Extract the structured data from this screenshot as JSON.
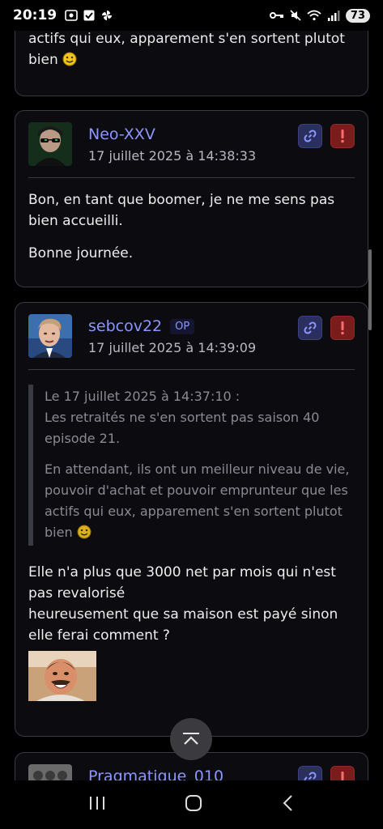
{
  "status_bar": {
    "time": "20:19",
    "battery": "73"
  },
  "posts": [
    {
      "fragment_text": "pouvoir d'achat et pouvoir emprunteur que les actifs qui eux, apparement s'en sortent plutot bien"
    },
    {
      "author": "Neo-XXV",
      "date": "17 juillet 2025 à 14:38:33",
      "paragraphs": [
        "Bon, en tant que boomer, je ne me sens pas bien accueilli.",
        "Bonne journée."
      ]
    },
    {
      "author": "sebcov22",
      "badge": "OP",
      "date": "17 juillet 2025 à 14:39:09",
      "quote_header": "Le 17 juillet 2025 à 14:37:10 :",
      "quote_line1": "Les retraités ne s'en sortent pas saison 40 episode 21.",
      "quote_line2": "En attendant, ils ont un meilleur niveau de vie, pouvoir d'achat et pouvoir emprunteur que les actifs qui eux, apparement s'en sortent plutot bien",
      "body_line1": "Elle n'a plus que 3000 net par mois qui n'est pas revalorisé",
      "body_line2": "heureusement que sa maison est payé sinon elle ferai comment ?"
    },
    {
      "author": "Pragmatique_010"
    }
  ],
  "icons": {
    "link": "link-icon",
    "report": "exclamation-icon",
    "scroll_top": "chevron-up-icon"
  },
  "colors": {
    "author": "#8c96ff",
    "report": "#7a1c1c",
    "link": "#2a2f5e"
  }
}
